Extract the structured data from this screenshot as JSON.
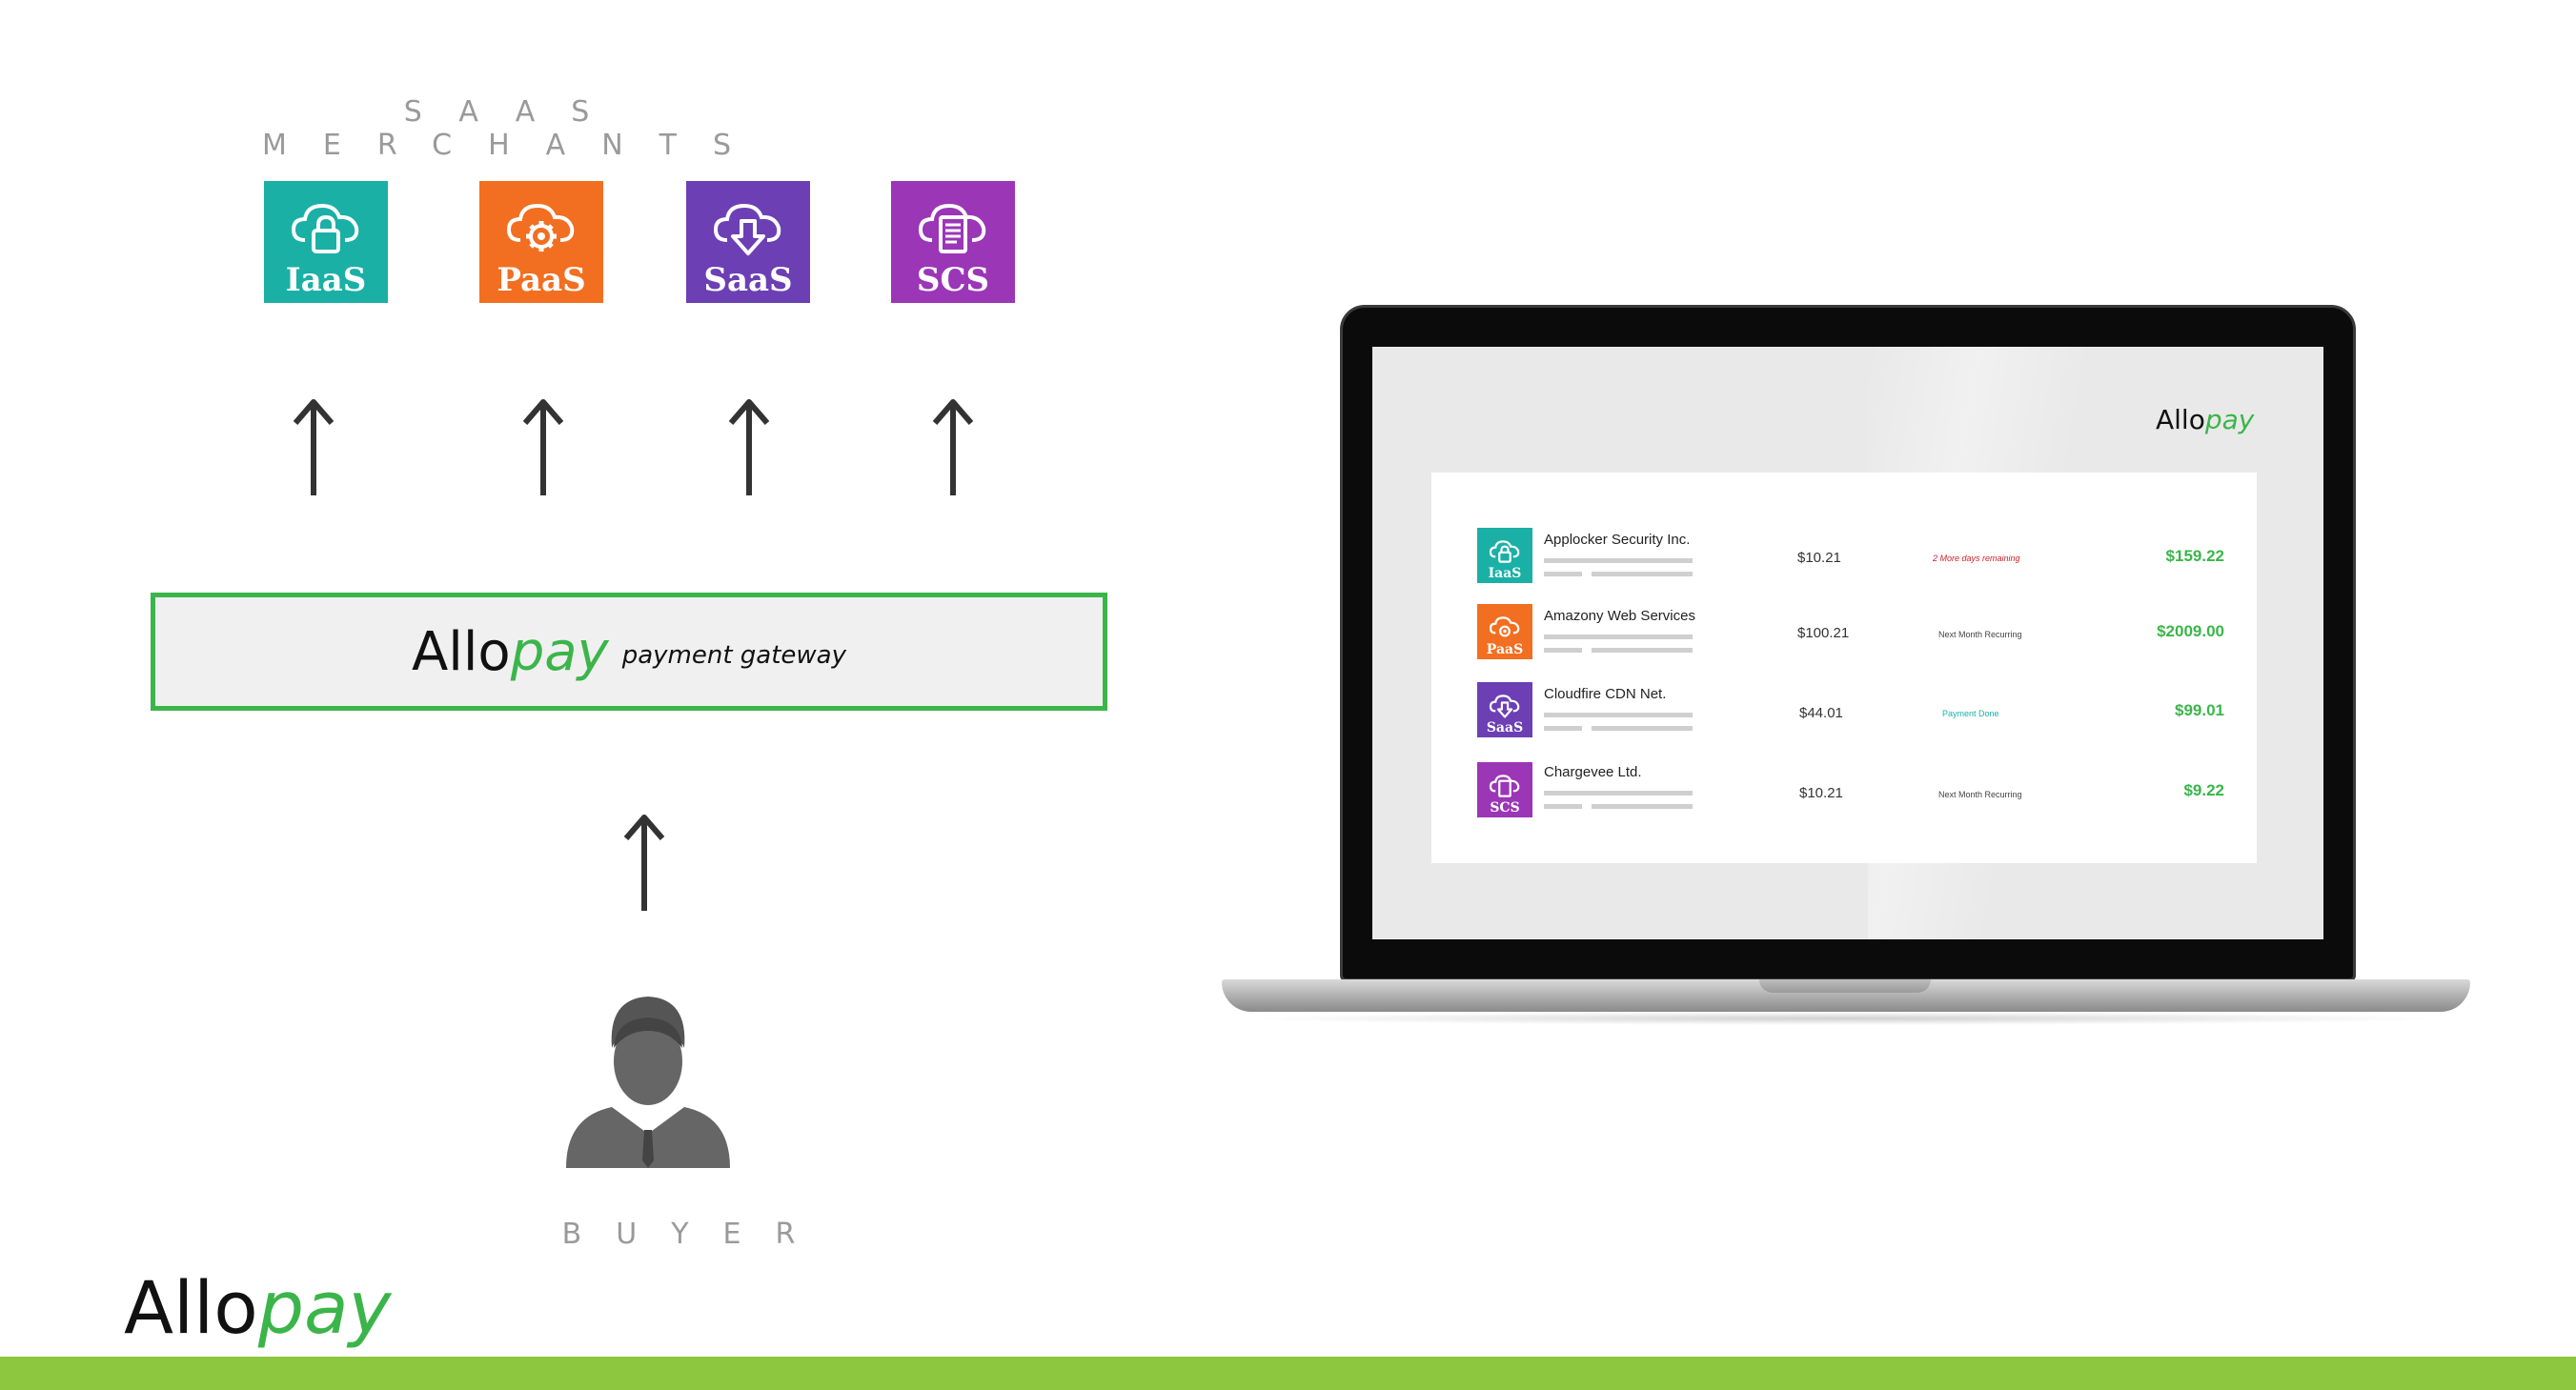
{
  "merchants": {
    "title": "SAAS MERCHANTS",
    "tiles": [
      {
        "label": "IaaS",
        "icon": "cloud-lock-icon",
        "color": "#1ab0a6"
      },
      {
        "label": "PaaS",
        "icon": "cloud-gear-icon",
        "color": "#f26f21"
      },
      {
        "label": "SaaS",
        "icon": "cloud-download-icon",
        "color": "#6c3fb5"
      },
      {
        "label": "SCS",
        "icon": "cloud-document-icon",
        "color": "#9b36b7"
      }
    ]
  },
  "gateway": {
    "brand_allo": "Allo",
    "brand_pay": "pay",
    "caption": "payment gateway"
  },
  "buyer": {
    "label": "BUYER",
    "icon": "person-icon"
  },
  "logo": {
    "allo": "Allo",
    "pay": "pay"
  },
  "laptop": {
    "logo": {
      "allo": "Allo",
      "pay": "pay"
    },
    "rows": [
      {
        "icon_label": "IaaS",
        "color": "#1ab0a6",
        "icon": "cloud-lock-icon",
        "name": "Applocker Security Inc.",
        "price": "$10.21",
        "status": "2 More days remaining",
        "status_color": "#d0202b",
        "total": "$159.22"
      },
      {
        "icon_label": "PaaS",
        "color": "#f26f21",
        "icon": "cloud-gear-icon",
        "name": "Amazony Web Services",
        "price": "$100.21",
        "status": "Next Month Recurring",
        "status_color": "#444444",
        "total": "$2009.00"
      },
      {
        "icon_label": "SaaS",
        "color": "#6c3fb5",
        "icon": "cloud-download-icon",
        "name": "Cloudfire CDN Net.",
        "price": "$44.01",
        "status": "Payment Done",
        "status_color": "#1ab0a6",
        "total": "$99.01"
      },
      {
        "icon_label": "SCS",
        "color": "#9b36b7",
        "icon": "cloud-document-icon",
        "name": "Chargevee Ltd.",
        "price": "$10.21",
        "status": "Next Month Recurring",
        "status_color": "#444444",
        "total": "$9.22"
      }
    ]
  },
  "colors": {
    "brand_green": "#3bb54a",
    "bar_green": "#8dc63f"
  }
}
